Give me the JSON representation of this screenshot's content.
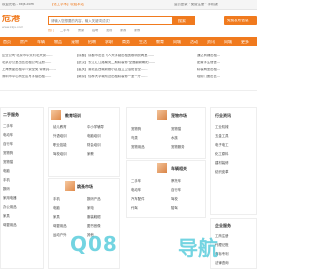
{
  "topbar": {
    "welcome": "欢迎光临 - kkjs.com",
    "site": "【化工学术】收藏本站",
    "right_links": "会员登录 · 免费注册 · 手机版"
  },
  "header": {
    "logo_text": "危港",
    "logo_sub": "www.kkjs.com",
    "search_placeholder": "请输入您想要的内容，输入关键词试试！",
    "search_btn": "搜索",
    "publish_btn": "免费发布信息",
    "hot_words": [
      "热门",
      "二手车",
      "房屋",
      "招聘",
      "宠物",
      "家政",
      "家教"
    ]
  },
  "nav": {
    "items": [
      "首页",
      "房产",
      "车辆",
      "物品",
      "宠物",
      "招聘",
      "求职",
      "商务",
      "生活",
      "教育",
      "同城",
      "活动",
      "资讯",
      "同城",
      "更多"
    ]
  },
  "ticker": {
    "left": [
      "企业公司·北京市中关村北大街……",
      "北京办公室出售出租公司注册……",
      "上海房屋出租中介费全免 带家具……",
      "深圳市中心商业区写字楼出租……",
      "广州二手车出售 诚信交易……"
    ],
    "center": [
      "【成都】成都市出售飞人大学路出租宽敞明亮两室……",
      "【武汉】长江汇江路南苑二期精装修·全面翻新朝阳……",
      "【重庆】渝北区西城新都小区独立卫浴阳台全……",
      "【南京】仙林大学城附近出租精装修一室一厅……",
      "【杭州】西湖区文三路附近出租单身公寓……"
    ],
    "right": [
      "通达商铺出租...",
      "配置学生宿舍...",
      "精装两室出租...",
      "临街门面出售...",
      "写字楼分割出租..."
    ]
  },
  "sections": {
    "s1": {
      "title": "二手服务",
      "items": [
        "二手车",
        "电动车",
        "自行车",
        "宠物狗",
        "宠物猫",
        "电脑",
        "手机",
        "数码",
        "家用电器",
        "办公用品",
        "家具",
        "母婴用品"
      ]
    },
    "s2": {
      "title": "教育培训",
      "items": [
        "幼儿教育",
        "中小学辅导",
        "外语培训",
        "电脑培训",
        "职业技能",
        "财会培训",
        "驾校培训",
        "家教"
      ]
    },
    "s3": {
      "title": "宠物市场",
      "items": [
        "宠物狗",
        "宠物猫",
        "鸟类",
        "水族",
        "宠物用品",
        "宠物服务"
      ]
    },
    "s4": {
      "title": "车辆相关",
      "items": [
        "二手车",
        "摩托车",
        "电动车",
        "自行车",
        "汽车配件",
        "驾校",
        "代驾",
        "陪驾"
      ]
    },
    "s5": {
      "title": "跳蚤市场",
      "items": [
        "手机",
        "数码产品",
        "电脑",
        "家电",
        "家具",
        "服装鞋帽",
        "母婴用品",
        "图书音像",
        "运动户外",
        "其他"
      ]
    },
    "s6": {
      "title": "行业资讯",
      "items": [
        "工业机械",
        "五金工具",
        "电子电工",
        "化工原料",
        "建材装修",
        "纺织皮革"
      ]
    },
    "s7": {
      "title": "企业服务",
      "items": [
        "工商注册",
        "代理记账",
        "商标专利",
        "法律咨询"
      ]
    }
  },
  "watermark": "Q08",
  "watermark2": "导航"
}
